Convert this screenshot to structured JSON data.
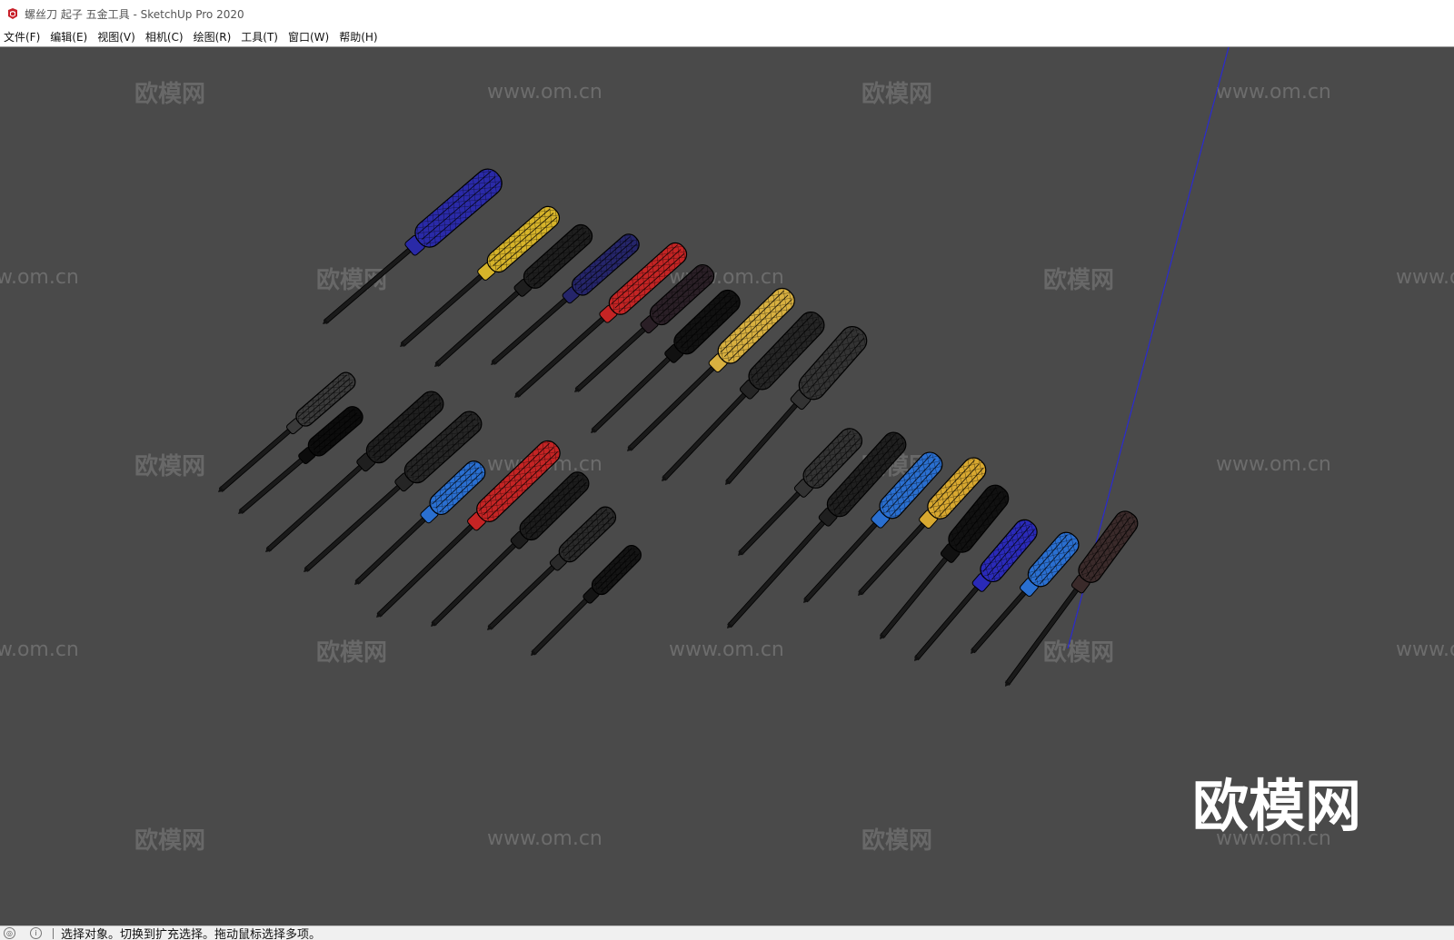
{
  "window": {
    "title": "螺丝刀 起子 五金工具 - SketchUp Pro 2020",
    "app_icon": "sketchup-logo-icon",
    "accent_color": "#c8202a"
  },
  "menu": {
    "items": [
      {
        "label": "文件(F)"
      },
      {
        "label": "编辑(E)"
      },
      {
        "label": "视图(V)"
      },
      {
        "label": "相机(C)"
      },
      {
        "label": "绘图(R)"
      },
      {
        "label": "工具(T)"
      },
      {
        "label": "窗口(W)"
      },
      {
        "label": "帮助(H)"
      }
    ]
  },
  "viewport": {
    "background": "#4a4a4a",
    "watermark_text": "www.om.cn",
    "watermark_cn": "欧模网",
    "logo_cn": "欧模网",
    "axis_color": "#2a2ad0"
  },
  "status": {
    "icons": [
      "geo-location-icon",
      "info-icon"
    ],
    "text": "选择对象。切换到扩充选择。拖动鼠标选择多项。"
  }
}
